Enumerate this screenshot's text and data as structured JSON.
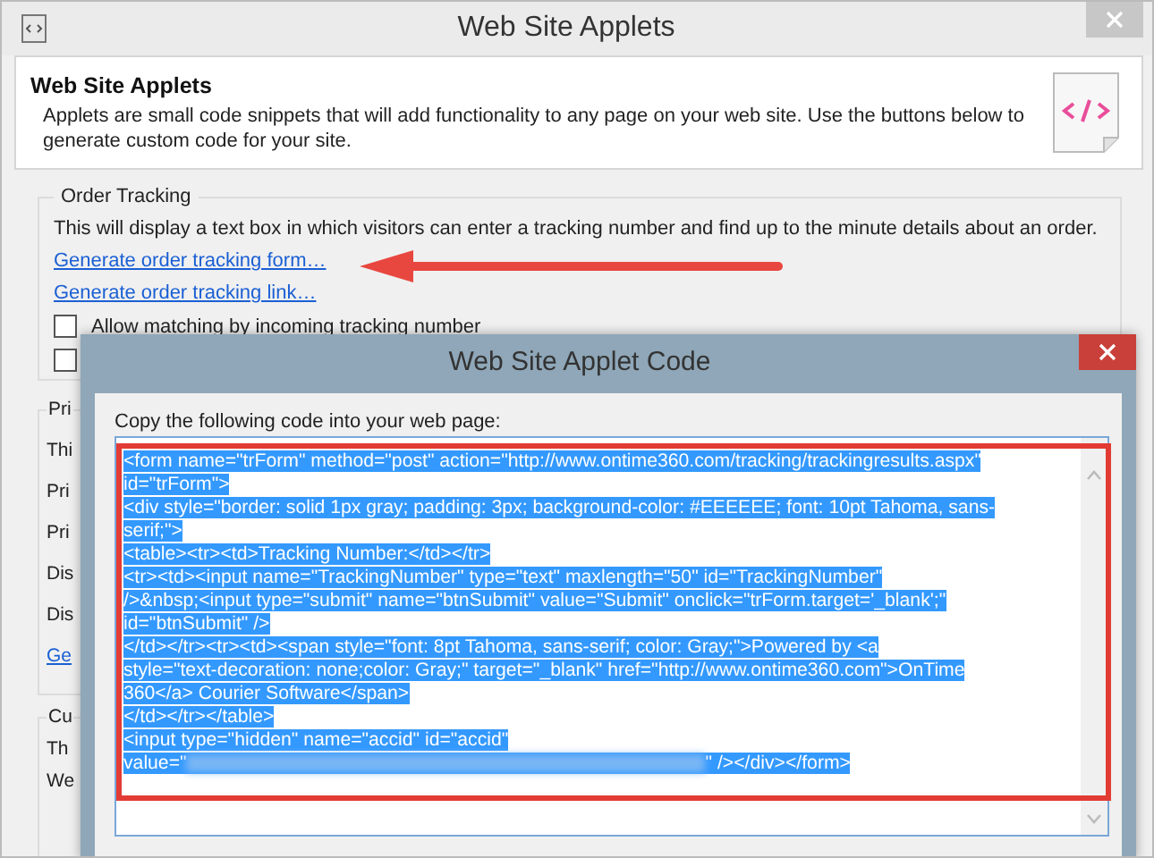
{
  "window": {
    "title": "Web Site Applets"
  },
  "header": {
    "title": "Web Site Applets",
    "description": "Applets are small code snippets that will add functionality to any page on your web site. Use the buttons below to generate custom code for your site."
  },
  "order_tracking": {
    "title": "Order Tracking",
    "description": "This will display a text box in which visitors can enter a tracking number and find up to the minute details about an order.",
    "links": [
      "Generate order tracking form…",
      "Generate order tracking link…"
    ],
    "checkboxes": [
      {
        "label": "Allow matching by incoming tracking number",
        "checked": false
      },
      {
        "checked": false
      }
    ]
  },
  "group_2": {
    "title": "Pri",
    "rows": [
      {
        "kind": "text",
        "text": "Thi"
      },
      {
        "kind": "text",
        "text": "Pri"
      },
      {
        "kind": "text",
        "text": "Pri"
      },
      {
        "kind": "text",
        "text": "Dis"
      },
      {
        "kind": "text",
        "text": "Dis"
      },
      {
        "kind": "link",
        "text": "Ge"
      }
    ]
  },
  "group_3": {
    "title": "Cu",
    "rows": [
      {
        "kind": "text",
        "text": "Th"
      },
      {
        "kind": "text",
        "text": "We"
      }
    ]
  },
  "dialog": {
    "title": "Web Site Applet Code",
    "instruction": "Copy the following code into your web page:",
    "selected": true,
    "code_lines": [
      {
        "text": "<form name=\"trForm\" method=\"post\" action=\"http://www.ontime360.com/tracking/trackingresults.aspx\""
      },
      {
        "text": "id=\"trForm\">"
      },
      {
        "text": "<div style=\"border: solid 1px gray; padding: 3px; background-color: #EEEEEE; font: 10pt Tahoma, sans-"
      },
      {
        "text": "serif;\">"
      },
      {
        "text": "<table><tr><td>Tracking Number:</td></tr>"
      },
      {
        "text": "<tr><td><input name=\"TrackingNumber\" type=\"text\" maxlength=\"50\" id=\"TrackingNumber\""
      },
      {
        "text": "/>&nbsp;<input type=\"submit\" name=\"btnSubmit\" value=\"Submit\" onclick=\"trForm.target='_blank';\""
      },
      {
        "text": "id=\"btnSubmit\" />"
      },
      {
        "text": "</td></tr><tr><td><span style=\"font: 8pt Tahoma, sans-serif; color: Gray;\">Powered by <a"
      },
      {
        "text": "style=\"text-decoration: none;color: Gray;\" target=\"_blank\" href=\"http://www.ontime360.com\">OnTime"
      },
      {
        "text": "360</a> Courier Software</span>"
      },
      {
        "text": "</td></tr></table>"
      },
      {
        "text": "<input type=\"hidden\" name=\"accid\" id=\"accid\""
      },
      {
        "text": "value=\"",
        "redacted": true,
        "after": "\" /></div></form>"
      }
    ]
  }
}
